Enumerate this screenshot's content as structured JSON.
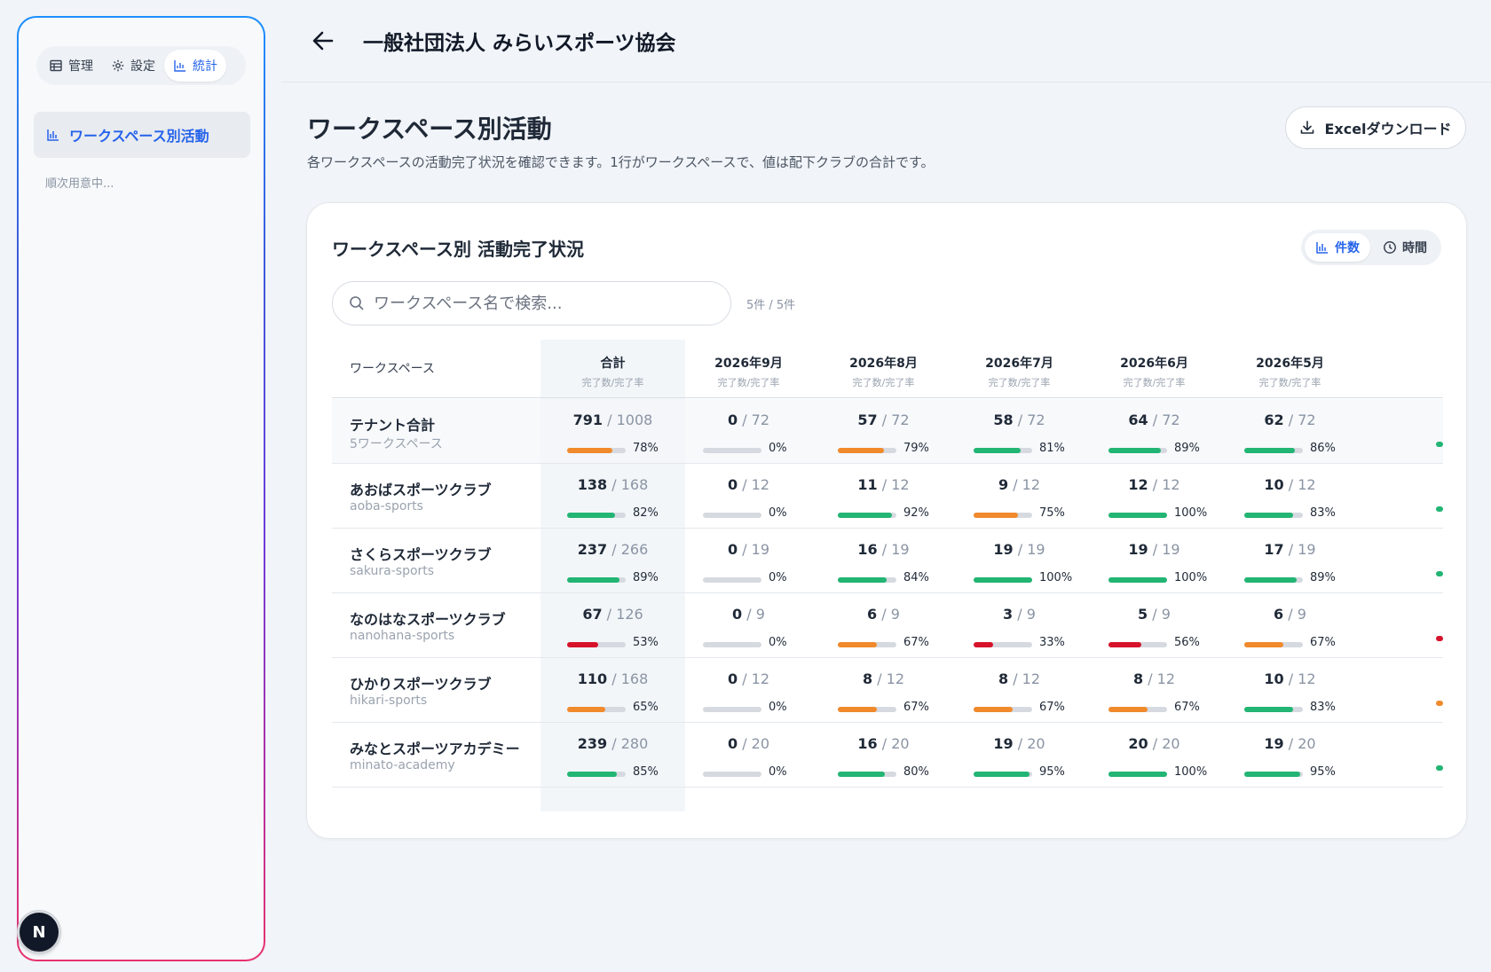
{
  "sidebar": {
    "tabs": [
      {
        "label": "管理",
        "icon": "table-icon"
      },
      {
        "label": "設定",
        "icon": "gear-icon"
      },
      {
        "label": "統計",
        "icon": "chart-icon"
      }
    ],
    "nav_item": "ワークスペース別活動",
    "note": "順次用意中...",
    "avatar_letter": "N"
  },
  "header": {
    "title": "一般社団法人 みらいスポーツ協会"
  },
  "page": {
    "title": "ワークスペース別活動",
    "subtitle": "各ワークスペースの活動完了状況を確認できます。1行がワークスペースで、値は配下クラブの合計です。",
    "excel_button": "Excelダウンロード"
  },
  "card": {
    "title": "ワークスペース別 活動完了状況",
    "toggle": [
      {
        "label": "件数"
      },
      {
        "label": "時間"
      }
    ],
    "search_placeholder": "ワークスペース名で検索...",
    "count": "5件 / 5件"
  },
  "table": {
    "ws_header": "ワークスペース",
    "sub_header": "完了数/完了率",
    "columns": [
      "合計",
      "2026年9月",
      "2026年8月",
      "2026年7月",
      "2026年6月",
      "2026年5月"
    ],
    "rows": [
      {
        "name": "テナント合計",
        "slug": "5ワークスペース",
        "tenant": true,
        "cells": [
          [
            "791",
            "1008",
            "78%"
          ],
          [
            "0",
            "72",
            "0%"
          ],
          [
            "57",
            "72",
            "79%"
          ],
          [
            "58",
            "72",
            "81%"
          ],
          [
            "64",
            "72",
            "89%"
          ],
          [
            "62",
            "72",
            "86%"
          ]
        ],
        "edge": "#22b573"
      },
      {
        "name": "あおばスポーツクラブ",
        "slug": "aoba-sports",
        "cells": [
          [
            "138",
            "168",
            "82%"
          ],
          [
            "0",
            "12",
            "0%"
          ],
          [
            "11",
            "12",
            "92%"
          ],
          [
            "9",
            "12",
            "75%"
          ],
          [
            "12",
            "12",
            "100%"
          ],
          [
            "10",
            "12",
            "83%"
          ]
        ],
        "edge": "#22b573"
      },
      {
        "name": "さくらスポーツクラブ",
        "slug": "sakura-sports",
        "cells": [
          [
            "237",
            "266",
            "89%"
          ],
          [
            "0",
            "19",
            "0%"
          ],
          [
            "16",
            "19",
            "84%"
          ],
          [
            "19",
            "19",
            "100%"
          ],
          [
            "19",
            "19",
            "100%"
          ],
          [
            "17",
            "19",
            "89%"
          ]
        ],
        "edge": "#22b573"
      },
      {
        "name": "なのはなスポーツクラブ",
        "slug": "nanohana-sports",
        "cells": [
          [
            "67",
            "126",
            "53%"
          ],
          [
            "0",
            "9",
            "0%"
          ],
          [
            "6",
            "9",
            "67%"
          ],
          [
            "3",
            "9",
            "33%"
          ],
          [
            "5",
            "9",
            "56%"
          ],
          [
            "6",
            "9",
            "67%"
          ]
        ],
        "edge": "#d6132a"
      },
      {
        "name": "ひかりスポーツクラブ",
        "slug": "hikari-sports",
        "cells": [
          [
            "110",
            "168",
            "65%"
          ],
          [
            "0",
            "12",
            "0%"
          ],
          [
            "8",
            "12",
            "67%"
          ],
          [
            "8",
            "12",
            "67%"
          ],
          [
            "8",
            "12",
            "67%"
          ],
          [
            "10",
            "12",
            "83%"
          ]
        ],
        "edge": "#f08a2c"
      },
      {
        "name": "みなとスポーツアカデミー",
        "slug": "minato-academy",
        "cells": [
          [
            "239",
            "280",
            "85%"
          ],
          [
            "0",
            "20",
            "0%"
          ],
          [
            "16",
            "20",
            "80%"
          ],
          [
            "19",
            "20",
            "95%"
          ],
          [
            "20",
            "20",
            "100%"
          ],
          [
            "19",
            "20",
            "95%"
          ]
        ],
        "edge": "#22b573"
      }
    ]
  },
  "colors": {
    "green": "#22b573",
    "orange": "#f08a2c",
    "red": "#d6132a",
    "accent": "#2563eb"
  }
}
